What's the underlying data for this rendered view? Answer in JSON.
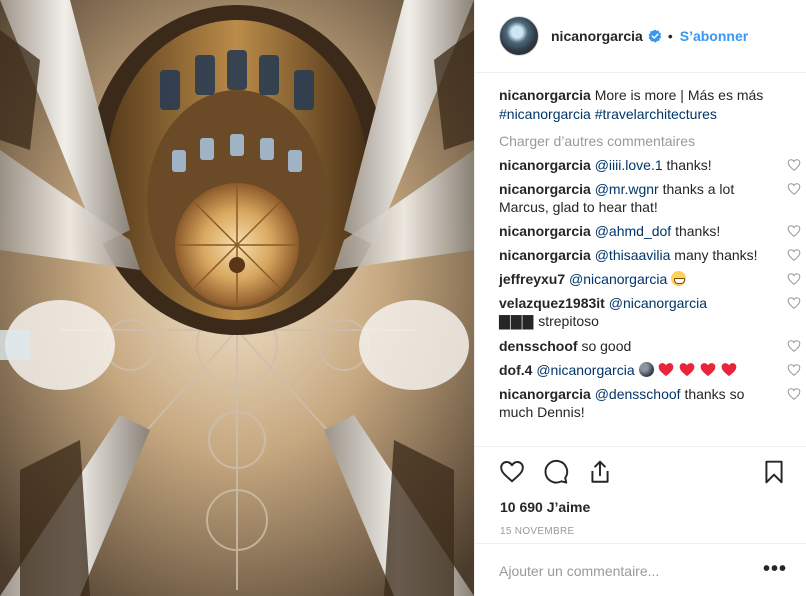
{
  "post": {
    "image_alt": "Cathedral vault",
    "author": "nicanorgarcia",
    "follow_label": "S’abonner",
    "separator": "•",
    "caption": {
      "user": "nicanorgarcia",
      "text": "More is more | Más es más",
      "tags": [
        "#nicanorgarcia",
        "#travelarchitectures"
      ]
    },
    "load_more_label": "Charger d’autres commentaires",
    "comments": [
      {
        "user": "nicanorgarcia",
        "mention": "@iiii.love.1",
        "text": "thanks!"
      },
      {
        "user": "nicanorgarcia",
        "mention": "@mr.wgnr",
        "text": "thanks a lot Marcus, glad to hear that!"
      },
      {
        "user": "nicanorgarcia",
        "mention": "@ahmd_dof",
        "text": "thanks!"
      },
      {
        "user": "nicanorgarcia",
        "mention": "@thisaavilia",
        "text": "many thanks!"
      },
      {
        "user": "jeffreyxu7",
        "mention": "@nicanorgarcia",
        "text": ""
      },
      {
        "user": "velazquez1983it",
        "mention": "@nicanorgarcia",
        "blocks": "▇▇▇",
        "text": "strepitoso"
      },
      {
        "user": "densschoof",
        "mention": "",
        "text": "so good"
      },
      {
        "user": "dof.4",
        "mention": "@nicanorgarcia",
        "text": ""
      },
      {
        "user": "nicanorgarcia",
        "mention": "@densschoof",
        "text": "thanks so much Dennis!"
      }
    ],
    "likes_label": "10 690 J’aime",
    "date_label": "15 NOVEMBRE",
    "add_comment_placeholder": "Ajouter un commentaire...",
    "more_label": "•••"
  },
  "icons": {
    "verified": "verified-badge-icon",
    "like": "heart-outline-icon",
    "comment": "speech-bubble-icon",
    "share": "share-upload-icon",
    "save": "bookmark-icon",
    "comment_like": "small-heart-outline-icon",
    "more": "ellipsis-icon"
  },
  "colors": {
    "link_blue": "#3897f0",
    "hashtag": "#003569",
    "muted": "#999999",
    "text": "#262626",
    "border": "#efefef",
    "emoji_heart": "#e8253a"
  }
}
